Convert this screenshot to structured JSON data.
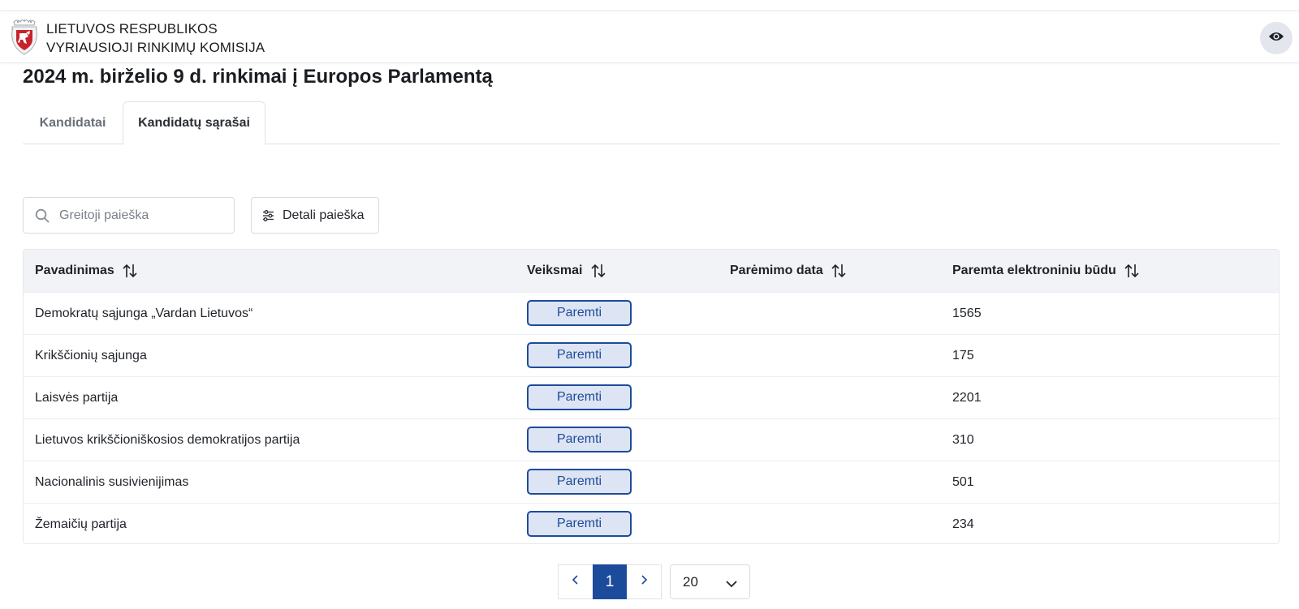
{
  "header": {
    "org_line1": "LIETUVOS RESPUBLIKOS",
    "org_line2": "VYRIAUSIOJI RINKIMŲ KOMISIJA",
    "logo_icon": "coat-of-arms-icon",
    "visibility_icon": "eye-icon"
  },
  "page": {
    "title": "2024 m. birželio 9 d. rinkimai į Europos Parlamentą"
  },
  "tabs": [
    {
      "label": "Kandidatai",
      "active": false
    },
    {
      "label": "Kandidatų sąrašai",
      "active": true
    }
  ],
  "search": {
    "placeholder": "Greitoji paieška",
    "value": "",
    "detail_label": "Detali paieška"
  },
  "table": {
    "columns": [
      {
        "label": "Pavadinimas"
      },
      {
        "label": "Veiksmai"
      },
      {
        "label": "Parėmimo data"
      },
      {
        "label": "Paremta elektroniniu būdu"
      }
    ],
    "rows": [
      {
        "name": "Demokratų sąjunga „Vardan Lietuvos“",
        "action": "Paremti",
        "date": "",
        "electronic": "1565"
      },
      {
        "name": "Krikščionių sąjunga",
        "action": "Paremti",
        "date": "",
        "electronic": "175"
      },
      {
        "name": "Laisvės partija",
        "action": "Paremti",
        "date": "",
        "electronic": "2201"
      },
      {
        "name": "Lietuvos krikščioniškosios demokratijos partija",
        "action": "Paremti",
        "date": "",
        "electronic": "310"
      },
      {
        "name": "Nacionalinis susivienijimas",
        "action": "Paremti",
        "date": "",
        "electronic": "501"
      },
      {
        "name": "Žemaičių partija",
        "action": "Paremti",
        "date": "",
        "electronic": "234"
      }
    ]
  },
  "pagination": {
    "current_page": "1",
    "page_size": "20"
  },
  "colors": {
    "primary": "#1d4b9b",
    "button_bg": "#dde4f3",
    "header_row_bg": "#f1f3f6"
  }
}
